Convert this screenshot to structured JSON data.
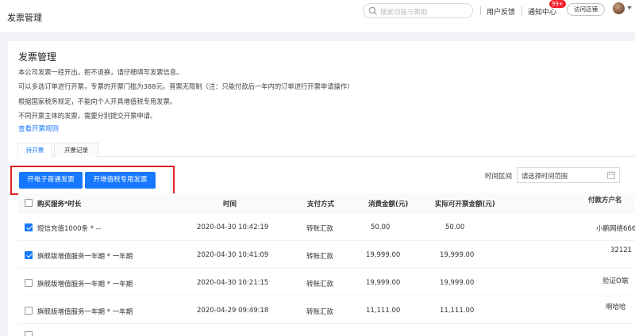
{
  "app": {
    "title": "发票管理"
  },
  "search": {
    "placeholder": "搜索功能与帮助"
  },
  "topnav": {
    "feedback": "用户反馈",
    "notifications": "通知中心",
    "badge": "99+",
    "visit_store": "访问店铺"
  },
  "page": {
    "title": "发票管理",
    "notes": [
      "本公司发票一经开出，拒不退换，请仔细填写发票信息。",
      "可以多选订单进行开票，专票的开票门槛为388元，普票无限制（注：只能付款后一年内的订单进行开票申请操作）",
      "根据国家税务规定，不能向个人开具增值税专用发票。",
      "不同开票主体的发票，需要分别提交开票申请。"
    ],
    "rules_link": "查看开票规则"
  },
  "tabs": [
    {
      "label": "待开票",
      "active": true
    },
    {
      "label": "开票记录",
      "active": false
    }
  ],
  "actions": {
    "e_invoice": "开电子普通发票",
    "vat_invoice": "开增值税专用发票",
    "time_range_label": "时间区间",
    "time_range_placeholder": "请选择时间范围"
  },
  "table": {
    "headers": {
      "service": "购买服务*时长",
      "time": "时间",
      "payment": "支付方式",
      "amount": "消费金额(元)",
      "invoiceable": "实际可开票金额(元)",
      "payer": "付款方户名"
    },
    "rows": [
      {
        "checked": true,
        "service": "短信充值1000条 * --",
        "time": "2020-04-30 10:42:19",
        "payment": "转账汇款",
        "amount": "50.00",
        "invoiceable": "50.00",
        "payer": "小鹏网络666"
      },
      {
        "checked": true,
        "service": "旗舰版增值服务一年期 * 一年期",
        "time": "2020-04-30 10:41:09",
        "payment": "转账汇款",
        "amount": "19,999.00",
        "invoiceable": "19,999.00",
        "payer": "32121"
      },
      {
        "checked": false,
        "service": "旗舰版增值服务一年期 * 一年期",
        "time": "2020-04-30 10:21:15",
        "payment": "转账汇款",
        "amount": "19,999.00",
        "invoiceable": "19,999.00",
        "payer": "验证O端"
      },
      {
        "checked": false,
        "service": "旗舰版增值服务一年期 * 一年期",
        "time": "2020-04-29 09:49:18",
        "payment": "转账汇款",
        "amount": "11,111.00",
        "invoiceable": "11,111.00",
        "payer": "啊哈哈"
      },
      {
        "checked": false,
        "service": "",
        "time": "",
        "payment": "",
        "amount": "",
        "invoiceable": "",
        "payer": ""
      }
    ]
  },
  "colors": {
    "accent": "#1677ff",
    "highlight": "#e02020",
    "badge": "#f5222d"
  }
}
